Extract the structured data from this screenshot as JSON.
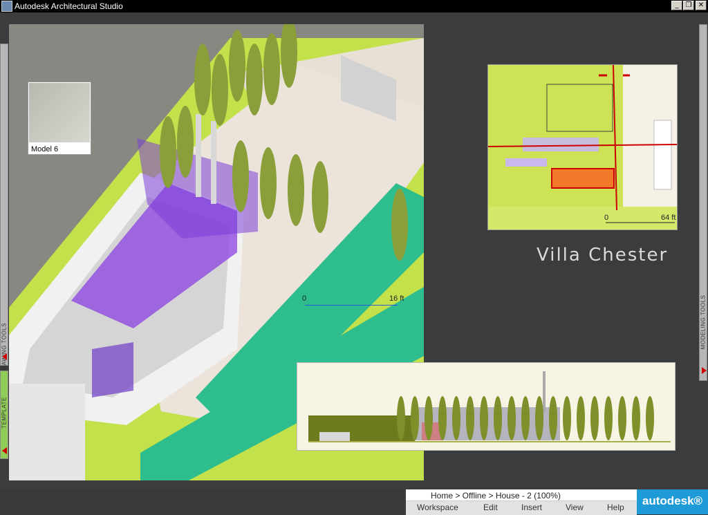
{
  "window": {
    "title": "Autodesk Architectural Studio"
  },
  "side_tabs": {
    "drawing_tools": "DRAWING TOOLS",
    "template": "TEMPLATE",
    "modeling_tools": "MODELING TOOLS"
  },
  "thumbnail": {
    "label": "Model 6"
  },
  "viewport_scale": {
    "start": "0",
    "end": "16 ft"
  },
  "plan_scale": {
    "start": "0",
    "end": "64 ft"
  },
  "project_title": "Villa Chester",
  "status": {
    "breadcrumb": "Home > Offline > House - 2 (100%)"
  },
  "menu": {
    "workspace": "Workspace",
    "edit": "Edit",
    "insert": "Insert",
    "view": "View",
    "help": "Help"
  },
  "brand": "autodesk®",
  "colors": {
    "accent_red": "#cc0000",
    "autodesk_blue": "#1e9ad6",
    "lime": "#cde254",
    "purple": "#7a3cc8",
    "teal": "#2fbf8a"
  }
}
